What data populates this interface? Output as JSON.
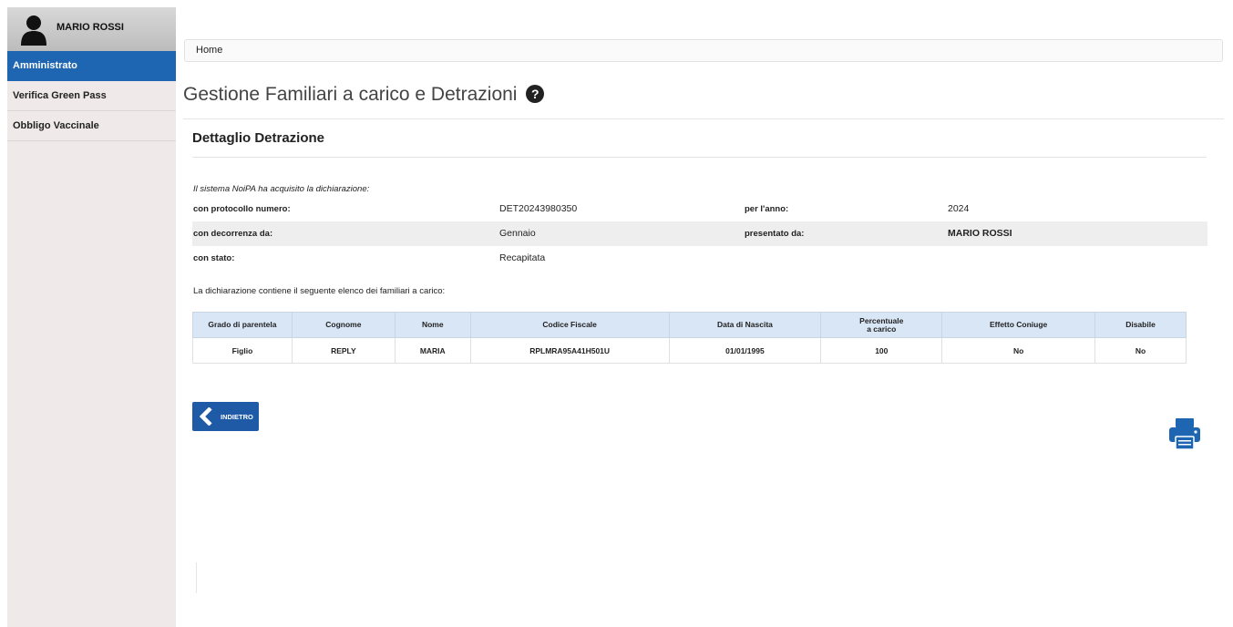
{
  "sidebar": {
    "user_name": "MARIO ROSSI",
    "items": [
      {
        "label": "Amministrato",
        "active": true
      },
      {
        "label": "Verifica Green Pass",
        "active": false
      },
      {
        "label": "Obbligo Vaccinale",
        "active": false
      }
    ]
  },
  "breadcrumb": {
    "home": "Home"
  },
  "page": {
    "title": "Gestione Familiari a carico e Detrazioni",
    "help_icon": "question-circle-icon",
    "section_title": "Dettaglio Detrazione"
  },
  "detail": {
    "intro": "Il sistema NoiPA ha acquisito la dichiarazione:",
    "protocol_label": "con protocollo numero:",
    "protocol_value": "DET20243980350",
    "year_label": "per l'anno:",
    "year_value": "2024",
    "start_label": "con decorrenza da:",
    "start_value": "Gennaio",
    "presented_label": "presentato da:",
    "presented_value": "MARIO ROSSI",
    "status_label": "con stato:",
    "status_value": "Recapitata",
    "list_intro": "La dichiarazione contiene il seguente elenco dei familiari a carico:"
  },
  "table": {
    "headers": {
      "grado": "Grado di parentela",
      "cognome": "Cognome",
      "nome": "Nome",
      "cf": "Codice Fiscale",
      "nascita": "Data di Nascita",
      "perc1": "Percentuale",
      "perc2": "a carico",
      "coniuge": "Effetto Coniuge",
      "disabile": "Disabile"
    },
    "rows": [
      {
        "grado": "Figlio",
        "cognome": "REPLY",
        "nome": "MARIA",
        "cf": "RPLMRA95A41H501U",
        "nascita": "01/01/1995",
        "perc": "100",
        "coniuge": "No",
        "disabile": "No"
      }
    ]
  },
  "buttons": {
    "back_label": "INDIETRO",
    "back_icon": "chevron-left-icon",
    "print_icon": "printer-icon"
  },
  "colors": {
    "primary": "#1f66b2",
    "table_header": "#d9e6f6",
    "sidebar_bg": "#efe9e9"
  }
}
